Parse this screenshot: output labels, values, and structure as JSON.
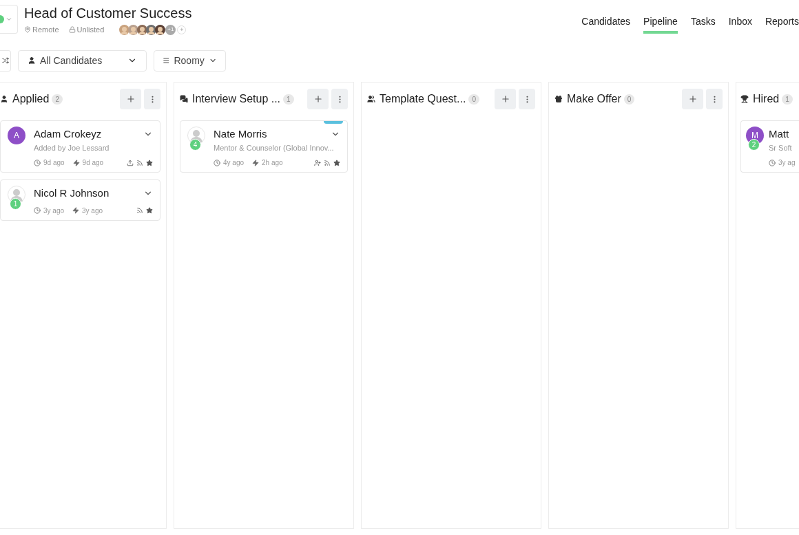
{
  "job": {
    "title": "Head of Customer Success",
    "location": "Remote",
    "visibility": "Unlisted",
    "team_more": "+1",
    "add_member": "+"
  },
  "nav": [
    {
      "label": "Candidates",
      "selected": false
    },
    {
      "label": "Pipeline",
      "selected": true
    },
    {
      "label": "Tasks",
      "selected": false
    },
    {
      "label": "Inbox",
      "selected": false
    },
    {
      "label": "Reports",
      "selected": false
    }
  ],
  "filters": {
    "audience": "All Candidates",
    "density": "Roomy"
  },
  "stages": [
    {
      "name": "Applied",
      "count": "2",
      "cards": [
        {
          "initial": "A",
          "name": "Adam Crokeyz",
          "subtitle": "Added by Joe Lessard",
          "created": "9d ago",
          "activity": "9d ago",
          "icons": [
            {
              "kind": "upload"
            },
            {
              "kind": "rss"
            },
            {
              "kind": "star"
            }
          ]
        },
        {
          "badge": "1",
          "name": "Nicol R Johnson",
          "created": "3y ago",
          "activity": "3y ago",
          "icons": [
            {
              "kind": "rss"
            },
            {
              "kind": "star"
            }
          ]
        }
      ]
    },
    {
      "name": "Interview Setup ...",
      "count": "1",
      "cards": [
        {
          "badge": "4",
          "name": "Nate Morris",
          "subtitle": "Mentor & Counselor (Global Innov...",
          "created": "4y ago",
          "activity": "2h ago",
          "icons": [
            {
              "kind": "user-plus"
            },
            {
              "kind": "rss"
            },
            {
              "kind": "star"
            }
          ],
          "color": "#5bc0de"
        }
      ]
    },
    {
      "name": "Template Quest...",
      "count": "0"
    },
    {
      "name": "Make Offer",
      "count": "0"
    },
    {
      "name": "Hired",
      "count": "1",
      "cards": [
        {
          "initial": "M",
          "badge": "2",
          "name": "Matt",
          "subtitle": "Sr Soft",
          "created": "3y ag"
        }
      ]
    }
  ]
}
